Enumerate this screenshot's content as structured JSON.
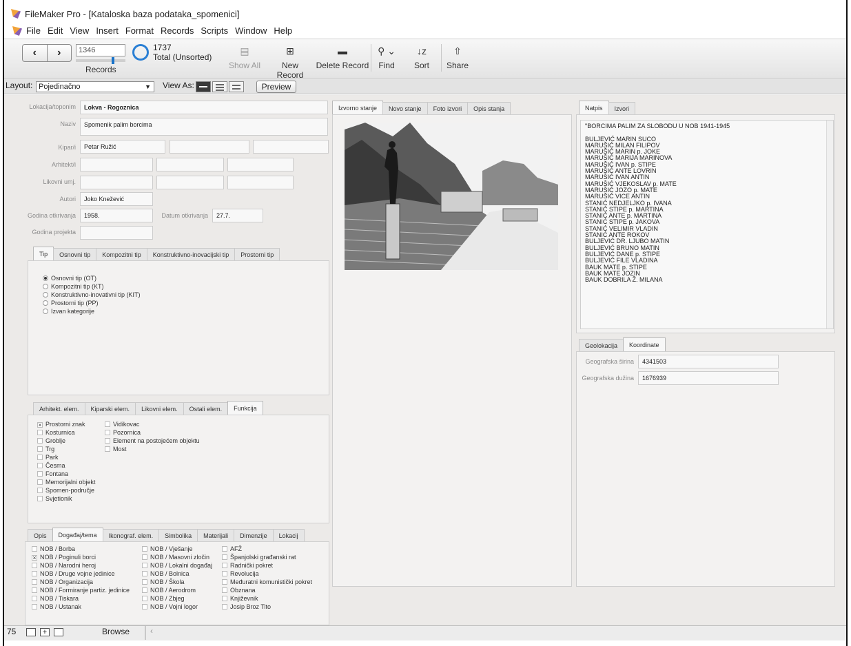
{
  "window": {
    "title": "FileMaker Pro - [Kataloska baza podataka_spomenici]"
  },
  "menu": [
    "File",
    "Edit",
    "View",
    "Insert",
    "Format",
    "Records",
    "Scripts",
    "Window",
    "Help"
  ],
  "toolbar": {
    "record_current": "1346",
    "records_label": "Records",
    "total_count": "1737",
    "total_status": "Total (Unsorted)",
    "progress": 0.77,
    "buttons": {
      "show_all": "Show All",
      "new_record": "New Record",
      "delete_record": "Delete Record",
      "find": "Find",
      "sort": "Sort",
      "share": "Share"
    },
    "find_icon": "search-icon",
    "sort_icon": "sort-icon",
    "share_icon": "share-icon"
  },
  "layoutbar": {
    "layout_label": "Layout:",
    "layout_value": "Pojedinačno",
    "view_as_label": "View As:",
    "preview_label": "Preview"
  },
  "form": {
    "lokacija_label": "Lokacija/toponim",
    "lokacija_value": "Lokva - Rogoznica",
    "naziv_label": "Naziv",
    "naziv_value": "Spomenik palim borcima",
    "kipar_label": "Kipar/i",
    "kipar_value": "Petar Ružić",
    "arhitekt_label": "Arhitekt/i",
    "likovni_label": "Likovni umj.",
    "autori_label": "Autori",
    "autori_value": "Joko Knežević",
    "godina_otkr_label": "Godina otkrivanja",
    "godina_otkr_value": "1958.",
    "datum_label": "Datum otkrivanja",
    "datum_value": "27.7.",
    "godina_proj_label": "Godina projekta"
  },
  "tip_tabs": [
    "Tip",
    "Osnovni tip",
    "Kompozitni tip",
    "Konstruktivno-inovacijski tip",
    "Prostorni tip"
  ],
  "tip_options": [
    {
      "label": "Osnovni tip (OT)",
      "selected": true
    },
    {
      "label": "Kompozitni tip (KT)",
      "selected": false
    },
    {
      "label": "Konstruktivno-inovativni tip (KIT)",
      "selected": false
    },
    {
      "label": "Prostorni tip (PP)",
      "selected": false
    },
    {
      "label": "Izvan kategorije",
      "selected": false
    }
  ],
  "elem_tabs": [
    "Arhitekt. elem.",
    "Kiparski elem.",
    "Likovni elem.",
    "Ostali elem.",
    "Funkcija"
  ],
  "funkcija_col1": [
    {
      "label": "Prostorni znak",
      "checked": true
    },
    {
      "label": "Kosturnica",
      "checked": false
    },
    {
      "label": "Groblje",
      "checked": false
    },
    {
      "label": "Trg",
      "checked": false
    },
    {
      "label": "Park",
      "checked": false
    },
    {
      "label": "Česma",
      "checked": false
    },
    {
      "label": "Fontana",
      "checked": false
    },
    {
      "label": "Memorijalni objekt",
      "checked": false
    },
    {
      "label": "Spomen-područje",
      "checked": false
    },
    {
      "label": "Svjetionik",
      "checked": false
    }
  ],
  "funkcija_col2": [
    {
      "label": "Vidikovac",
      "checked": false
    },
    {
      "label": "Pozornica",
      "checked": false
    },
    {
      "label": "Element na postojećem objektu",
      "checked": false
    },
    {
      "label": "Most",
      "checked": false
    }
  ],
  "opis_tabs": [
    "Opis",
    "Događaj/tema",
    "Ikonograf. elem.",
    "Simbolika",
    "Materijali",
    "Dimenzije",
    "Lokacij"
  ],
  "dogadaj_col1": [
    {
      "label": "NOB / Borba",
      "checked": false
    },
    {
      "label": "NOB / Poginuli borci",
      "checked": true
    },
    {
      "label": "NOB / Narodni heroj",
      "checked": false
    },
    {
      "label": "NOB / Druge vojne jedinice",
      "checked": false
    },
    {
      "label": "NOB / Organizacija",
      "checked": false
    },
    {
      "label": "NOB / Formiranje partiz. jedinice",
      "checked": false
    },
    {
      "label": "NOB / Tiskara",
      "checked": false
    },
    {
      "label": "NOB / Ustanak",
      "checked": false
    }
  ],
  "dogadaj_col2": [
    {
      "label": "NOB / Vješanje",
      "checked": false
    },
    {
      "label": "NOB / Masovni zločin",
      "checked": false
    },
    {
      "label": "NOB / Lokalni događaj",
      "checked": false
    },
    {
      "label": "NOB / Bolnica",
      "checked": false
    },
    {
      "label": "NOB / Škola",
      "checked": false
    },
    {
      "label": "NOB / Aerodrom",
      "checked": false
    },
    {
      "label": "NOB / Zbjeg",
      "checked": false
    },
    {
      "label": "NOB / Vojni logor",
      "checked": false
    }
  ],
  "dogadaj_col3": [
    {
      "label": "AFŽ",
      "checked": false
    },
    {
      "label": "Španjolski građanski rat",
      "checked": false
    },
    {
      "label": "Radnički pokret",
      "checked": false
    },
    {
      "label": "Revolucija",
      "checked": false
    },
    {
      "label": "Međuratni komunistički pokret",
      "checked": false
    },
    {
      "label": "Obznana",
      "checked": false
    },
    {
      "label": "Književnik",
      "checked": false
    },
    {
      "label": "Josip Broz Tito",
      "checked": false
    }
  ],
  "photo_tabs": [
    "Izvorno stanje",
    "Novo stanje",
    "Foto izvori",
    "Opis stanja"
  ],
  "natpis_tabs": [
    "Natpis",
    "Izvori"
  ],
  "natpis_text": "\"BORCIMA PALIM ZA SLOBODU U NOB 1941-1945\n\nBULJEVIĆ MARIN SUCO\nMARUŠIĆ MILAN FILIPOV\nMARUŠIĆ MARIN p. JOKE\nMARUŠIĆ MARIJA MARINOVA\nMARUŠIĆ IVAN p. STIPE\nMARUŠIĆ ANTE LOVRIN\nMARUŠIĆ IVAN ANTIN\nMARUŠIĆ VJEKOSLAV p. MATE\nMARUŠIĆ JOZO p. MATE\nMARUŠIĆ VICE ANTIN\nSTANIĆ NEDJELJKO p. IVANA\nSTANIĆ STIPE p. MARTINA\nSTANIĆ ANTE p. MARTINA\nSTANIĆ STIPE p. JAKOVA\nSTANIĆ VELIMIR VLADIN\nSTANIĆ ANTE ROKOV\nBULJEVIĆ DR. LJUBO MATIN\nBULJEVIĆ BRUNO MATIN\nBULJEVIĆ DANE p. STIPE\nBULJEVIĆ FILE VLADINA\nBAUK MATE p. STIPE\nBAUK MATE JOZIN\nBAUK DOBRILA Ž. MILANA",
  "geo_tabs": [
    "Geolokacija",
    "Koordinate"
  ],
  "geo": {
    "sirina_label": "Geografska širina",
    "sirina_value": "4341503",
    "duzina_label": "Geografska dužina",
    "duzina_value": "1676939"
  },
  "status": {
    "zoom": "75",
    "mode": "Browse"
  }
}
